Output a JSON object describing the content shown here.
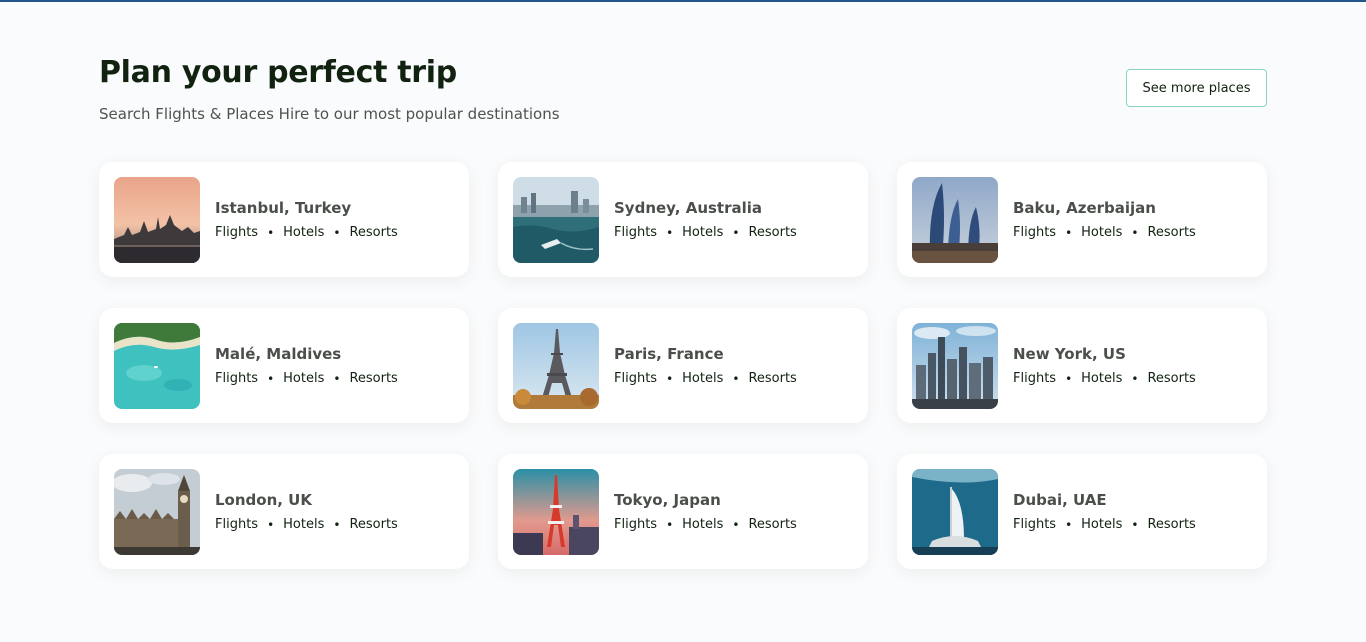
{
  "section": {
    "title": "Plan your perfect trip",
    "subtitle": "Search Flights & Places Hire to our most popular destinations",
    "see_more_label": "See more places"
  },
  "destinations": [
    {
      "city": "Istanbul, Turkey",
      "services": [
        "Flights",
        "Hotels",
        "Resorts"
      ],
      "image": "istanbul-skyline-sunset"
    },
    {
      "city": "Sydney, Australia",
      "services": [
        "Flights",
        "Hotels",
        "Resorts"
      ],
      "image": "sydney-harbour"
    },
    {
      "city": "Baku, Azerbaijan",
      "services": [
        "Flights",
        "Hotels",
        "Resorts"
      ],
      "image": "baku-flame-towers"
    },
    {
      "city": "Malé, Maldives",
      "services": [
        "Flights",
        "Hotels",
        "Resorts"
      ],
      "image": "maldives-lagoon"
    },
    {
      "city": "Paris, France",
      "services": [
        "Flights",
        "Hotels",
        "Resorts"
      ],
      "image": "eiffel-tower"
    },
    {
      "city": "New York, US",
      "services": [
        "Flights",
        "Hotels",
        "Resorts"
      ],
      "image": "new-york-skyline"
    },
    {
      "city": "London, UK",
      "services": [
        "Flights",
        "Hotels",
        "Resorts"
      ],
      "image": "big-ben-westminster"
    },
    {
      "city": "Tokyo, Japan",
      "services": [
        "Flights",
        "Hotels",
        "Resorts"
      ],
      "image": "tokyo-tower"
    },
    {
      "city": "Dubai, UAE",
      "services": [
        "Flights",
        "Hotels",
        "Resorts"
      ],
      "image": "burj-al-arab"
    }
  ],
  "colors": {
    "accent_border": "#8dd3bb",
    "top_line": "#24568e",
    "text_primary": "#112211",
    "background": "#fafbfc"
  }
}
